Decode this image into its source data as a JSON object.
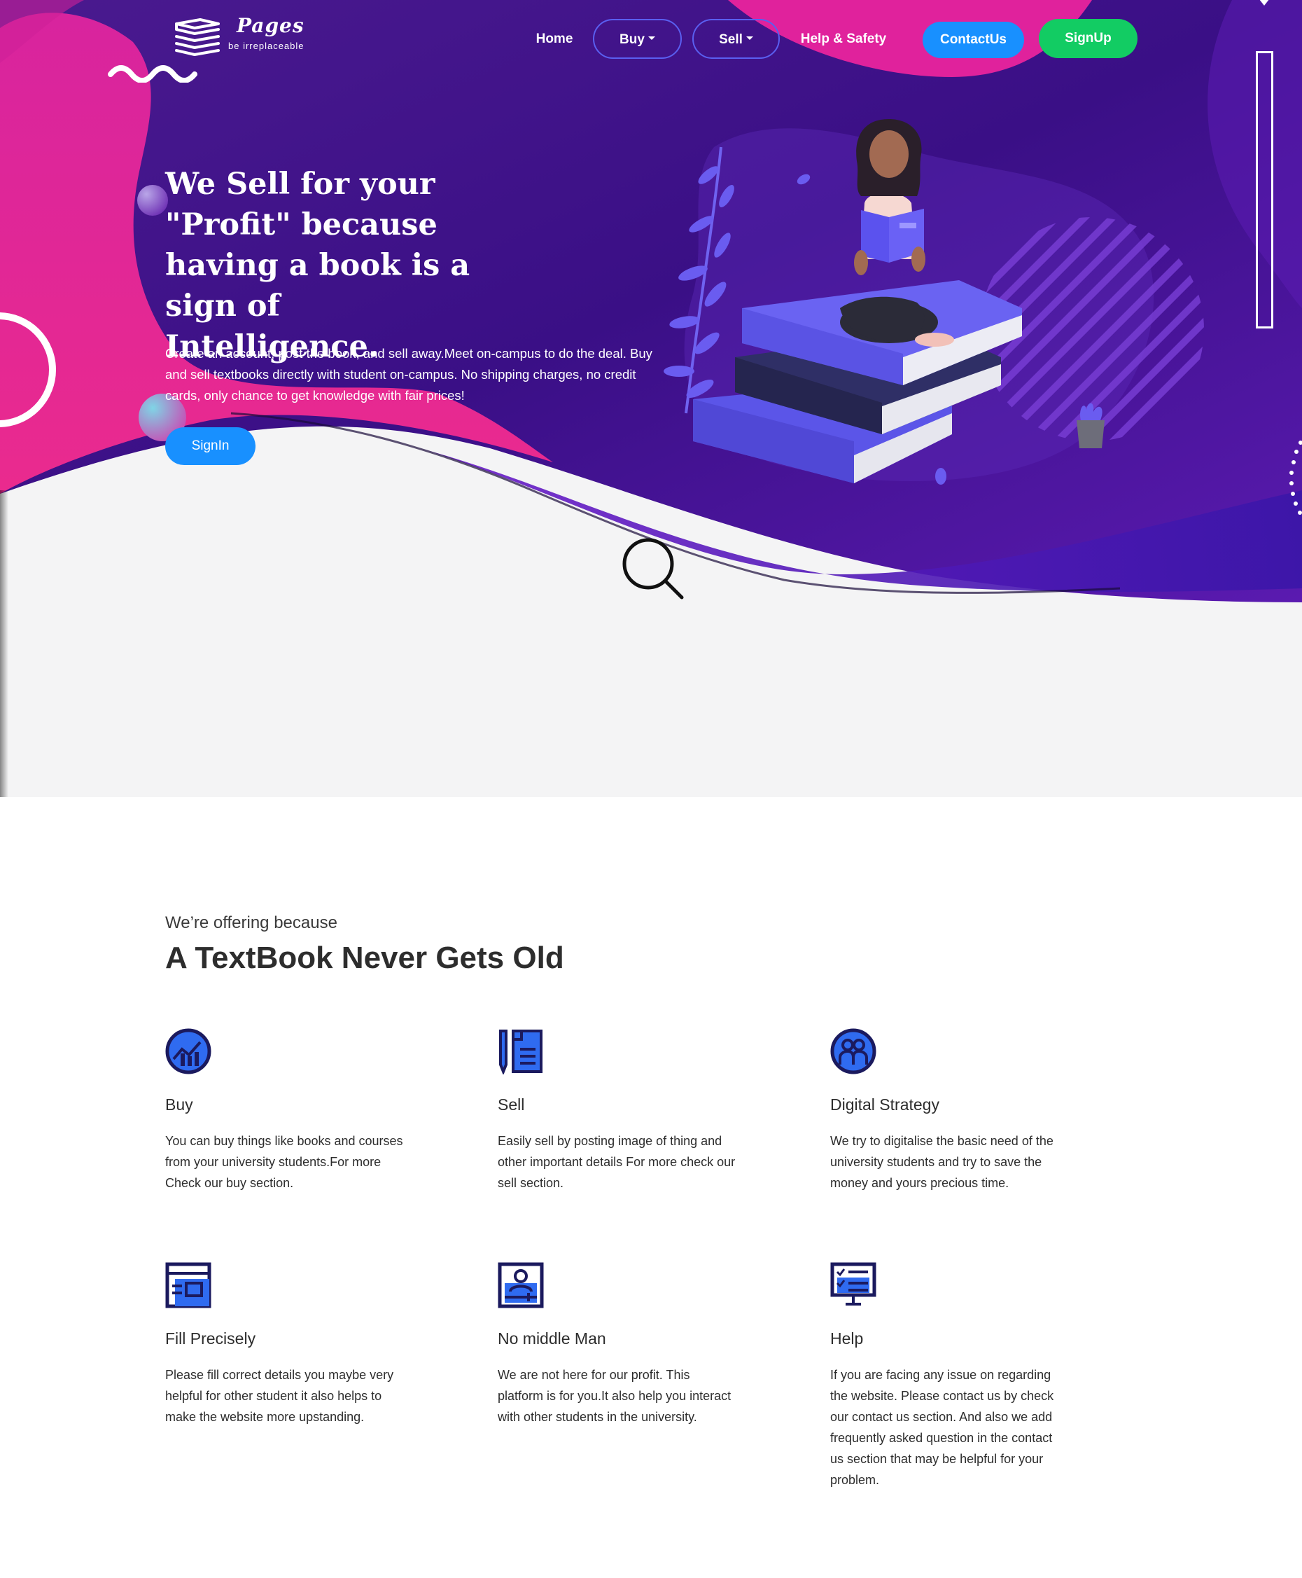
{
  "brand": {
    "name": "Pages",
    "tagline": "be irreplaceable"
  },
  "nav": {
    "home": "Home",
    "buy": "Buy",
    "sell": "Sell",
    "help": "Help & Safety",
    "contact": "ContactUs",
    "signup": "SignUp"
  },
  "hero": {
    "headline": "We Sell for your \"Profit\" because having a book is a sign of Intelligence.",
    "lead": "Create an account, post the book, and sell away.Meet on-campus to do the deal. Buy and sell textbooks directly with student on-campus. No shipping charges, no credit cards, only chance to get knowledge with fair prices!",
    "signin": "SignIn"
  },
  "features": {
    "eyebrow": "We’re offering because",
    "title": "A TextBook Never Gets Old",
    "items": [
      {
        "title": "Buy",
        "icon": "chart-up-icon",
        "text": "You can buy things like books and courses from your university students.For more Check our buy section."
      },
      {
        "title": "Sell",
        "icon": "document-pen-icon",
        "text": "Easily sell by posting image of thing and other important details For more check our sell section."
      },
      {
        "title": "Digital Strategy",
        "icon": "team-icon",
        "text": "We try to digitalise the basic need of the university students and try to save the money and yours precious time."
      },
      {
        "title": "Fill Precisely",
        "icon": "browser-form-icon",
        "text": "Please fill correct details you maybe very helpful for other student it also helps to make the website more upstanding."
      },
      {
        "title": "No middle Man",
        "icon": "user-profile-icon",
        "text": "We are not here for our profit. This platform is for you.It also help you interact with other students in the university."
      },
      {
        "title": "Help",
        "icon": "monitor-checklist-icon",
        "text": "If you are facing any issue on regarding the website. Please contact us by check our contact us section. And also we add frequently asked question in the contact us section that may be helpful for your problem."
      }
    ]
  },
  "colors": {
    "primary_blue": "#1890ff",
    "signup_green": "#12cc63",
    "hero_purple": "#3d128a",
    "hero_pink": "#e0239c",
    "icon_navy": "#1b1a5e",
    "icon_blue": "#2f6bf0"
  }
}
